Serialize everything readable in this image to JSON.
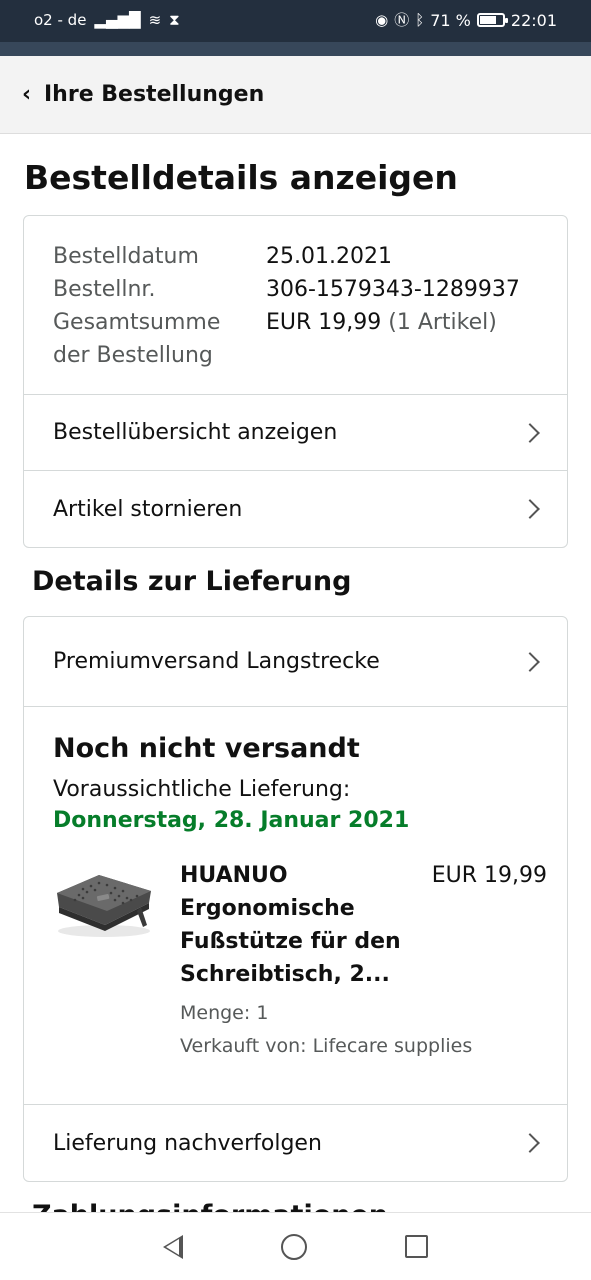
{
  "status_bar": {
    "carrier": "o2 - de",
    "battery_percent": "71 %",
    "battery_level": 0.71,
    "time": "22:01",
    "icons": [
      "signal-icon",
      "wifi-icon",
      "hourglass-icon",
      "eye-icon",
      "nfc-icon",
      "bluetooth-icon",
      "battery-icon"
    ]
  },
  "header": {
    "back_label": "Ihre Bestellungen"
  },
  "page_title": "Bestelldetails anzeigen",
  "order_summary": {
    "date_label": "Bestelldatum",
    "date_value": "25.01.2021",
    "number_label": "Bestellnr.",
    "number_value": "306-1579343-1289937",
    "total_label_line1": "Gesamtsumme",
    "total_label_line2": "der Bestellung",
    "total_value": "EUR 19,99",
    "total_items": "(1 Artikel)"
  },
  "order_links": [
    {
      "label": "Bestellübersicht anzeigen"
    },
    {
      "label": "Artikel stornieren"
    }
  ],
  "delivery": {
    "section_title": "Details zur Lieferung",
    "shipping_method": "Premiumversand Langstrecke",
    "status": "Noch nicht versandt",
    "eta_label": "Voraussichtliche Lieferung:",
    "eta_date": "Donnerstag, 28. Januar 2021",
    "eta_color": "#067d2a",
    "item": {
      "title": "HUANUO Ergonomische Fußstütze für den Schreibtisch, 2...",
      "price": "EUR 19,99",
      "quantity": "Menge: 1",
      "seller": "Verkauft von: Lifecare supplies"
    },
    "track_label": "Lieferung nachverfolgen"
  },
  "next_section_title_cutoff": "Zahlungsinformationen"
}
